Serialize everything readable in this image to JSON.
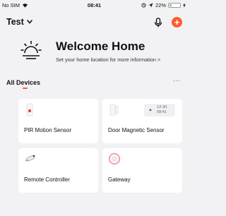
{
  "status_bar": {
    "carrier": "No SIM",
    "time": "08:41",
    "battery": "22%",
    "battery_level": 0.22
  },
  "header": {
    "home_name": "Test"
  },
  "welcome": {
    "title": "Welcome Home",
    "subtitle": "Set your home location for more information >"
  },
  "devices": {
    "section_title": "All Devices",
    "more_label": "···",
    "items": [
      {
        "name": "PIR Motion Sensor"
      },
      {
        "name": "Door Magnetic Sensor",
        "chip_date": "12-30",
        "chip_time": "08:41"
      },
      {
        "name": "Remote Controller"
      },
      {
        "name": "Gateway"
      }
    ]
  },
  "colors": {
    "accent": "#ff5a2e",
    "background": "#f2f2f4",
    "card": "#ffffff"
  }
}
